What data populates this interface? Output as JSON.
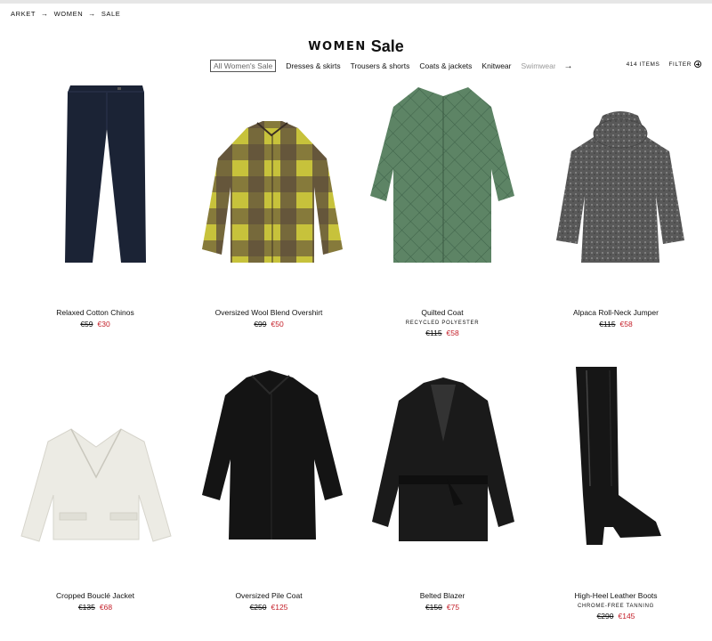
{
  "breadcrumb": {
    "items": [
      "ARKET",
      "WOMEN",
      "SALE"
    ]
  },
  "header": {
    "category": "WOMEN",
    "title": "Sale"
  },
  "nav": {
    "tabs": [
      "All Women's Sale",
      "Dresses & skirts",
      "Trousers & shorts",
      "Coats & jackets",
      "Knitwear",
      "Swimwear"
    ],
    "active_index": 0,
    "next_icon": "arrow-right-icon"
  },
  "toolbar": {
    "items_count": "414 ITEMS",
    "filter_label": "FILTER",
    "filter_icon": "plus-circle-icon"
  },
  "products": [
    {
      "name": "Relaxed Cotton Chinos",
      "tag": "",
      "old_price": "€59",
      "new_price": "€30"
    },
    {
      "name": "Oversized Wool Blend Overshirt",
      "tag": "",
      "old_price": "€99",
      "new_price": "€50"
    },
    {
      "name": "Quilted Coat",
      "tag": "RECYCLED POLYESTER",
      "old_price": "€115",
      "new_price": "€58"
    },
    {
      "name": "Alpaca Roll-Neck Jumper",
      "tag": "",
      "old_price": "€115",
      "new_price": "€58"
    },
    {
      "name": "Cropped Bouclé Jacket",
      "tag": "",
      "old_price": "€135",
      "new_price": "€68"
    },
    {
      "name": "Oversized Pile Coat",
      "tag": "",
      "old_price": "€250",
      "new_price": "€125"
    },
    {
      "name": "Belted Blazer",
      "tag": "",
      "old_price": "€150",
      "new_price": "€75"
    },
    {
      "name": "High-Heel Leather Boots",
      "tag": "CHROME-FREE TANNING",
      "old_price": "€290",
      "new_price": "€145"
    }
  ],
  "colors": {
    "sale_price": "#c4202a",
    "text": "#111111"
  }
}
